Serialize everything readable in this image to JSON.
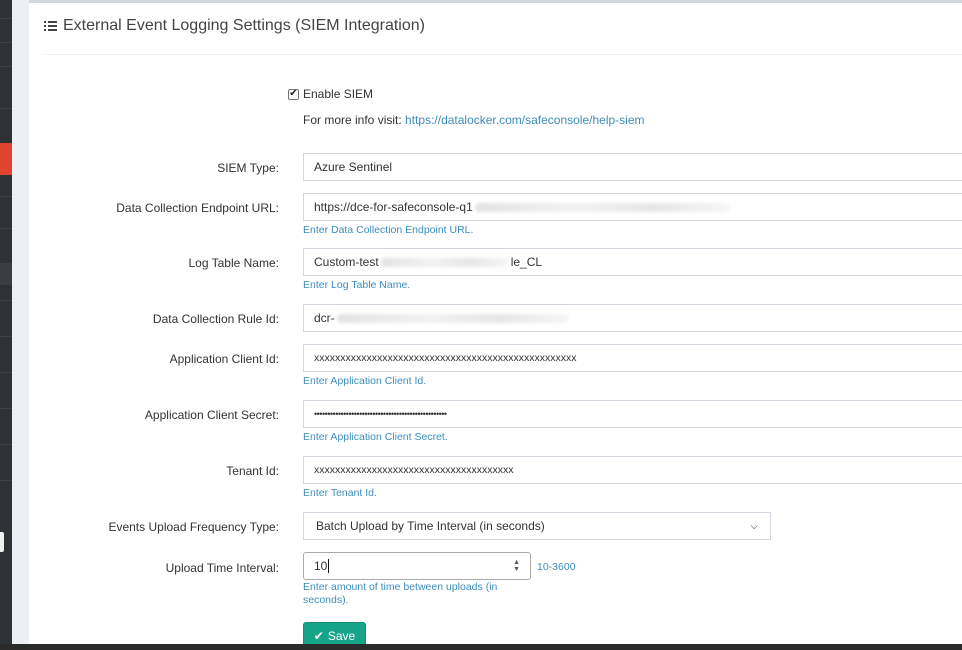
{
  "panel": {
    "title": "External Event Logging Settings (SIEM Integration)"
  },
  "enable_siem": {
    "label": "Enable SIEM",
    "checked": true,
    "info_prefix": "For more info visit:",
    "info_link": "https://datalocker.com/safeconsole/help-siem"
  },
  "fields": {
    "siem_type": {
      "label": "SIEM Type:",
      "value": "Azure Sentinel"
    },
    "dce_url": {
      "label": "Data Collection Endpoint URL:",
      "value": "https://dce-for-safeconsole-q1",
      "help": "Enter Data Collection Endpoint URL."
    },
    "log_table": {
      "label": "Log Table Name:",
      "value_prefix": "Custom-test",
      "value_suffix": "le_CL",
      "help": "Enter Log Table Name."
    },
    "dcr_id": {
      "label": "Data Collection Rule Id:",
      "value": "dcr-"
    },
    "client_id": {
      "label": "Application Client Id:",
      "value": "xxxxxxxxxxxxxxxxxxxxxxxxxxxxxxxxxxxxxxxxxxxxxxxxxx",
      "help": "Enter Application Client Id."
    },
    "client_secret": {
      "label": "Application Client Secret:",
      "value": "••••••••••••••••••••••••••••••••••••••••••••••••••",
      "help": "Enter Application Client Secret."
    },
    "tenant_id": {
      "label": "Tenant Id:",
      "value": "xxxxxxxxxxxxxxxxxxxxxxxxxxxxxxxxxxxxxx",
      "help": "Enter Tenant Id."
    },
    "upload_type": {
      "label": "Events Upload Frequency Type:",
      "value": "Batch Upload by Time Interval (in seconds)"
    },
    "upload_interval": {
      "label": "Upload Time Interval:",
      "value": "10",
      "range": "10-3600",
      "help": "Enter amount of time between uploads (in seconds)."
    }
  },
  "actions": {
    "save_label": "Save"
  },
  "icons": {
    "title_icon": "list-icon",
    "check_icon": "checkmark-icon",
    "select_icon": "chevron-down-icon",
    "spinner_icon": "spinner-arrows-icon",
    "save_icon": "checkmark-icon"
  },
  "colors": {
    "link": "#3c8dbc",
    "save_button": "#17a589",
    "sidebar_active": "#e0442f"
  }
}
